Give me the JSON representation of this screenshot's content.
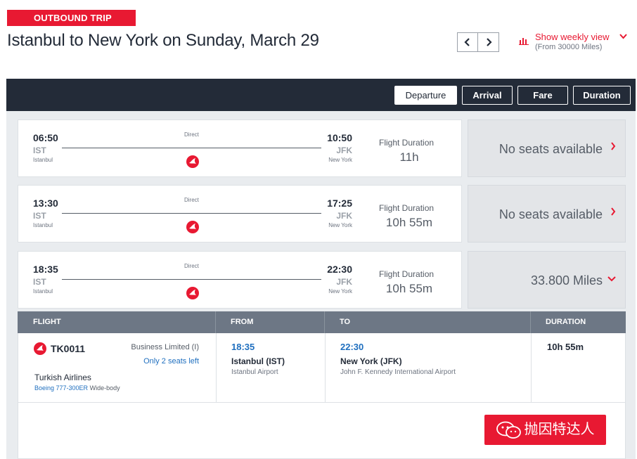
{
  "header": {
    "badge": "OUTBOUND TRIP",
    "title": "Istanbul to New York on Sunday, March 29",
    "weekly_label": "Show weekly view",
    "weekly_sub": "(From 30000 Miles)",
    "prev_icon": "chevron-left-icon",
    "next_icon": "chevron-right-icon"
  },
  "sort": {
    "departure": "Departure",
    "arrival": "Arrival",
    "fare": "Fare",
    "duration": "Duration",
    "active": "Departure"
  },
  "flights": [
    {
      "dep_time": "06:50",
      "dep_code": "IST",
      "dep_name": "Istanbul",
      "stops": "Direct",
      "arr_time": "10:50",
      "arr_code": "JFK",
      "arr_name": "New York",
      "duration_label": "Flight Duration",
      "duration": "11h",
      "fare": "No seats available"
    },
    {
      "dep_time": "13:30",
      "dep_code": "IST",
      "dep_name": "Istanbul",
      "stops": "Direct",
      "arr_time": "17:25",
      "arr_code": "JFK",
      "arr_name": "New York",
      "duration_label": "Flight Duration",
      "duration": "10h 55m",
      "fare": "No seats available"
    },
    {
      "dep_time": "18:35",
      "dep_code": "IST",
      "dep_name": "Istanbul",
      "stops": "Direct",
      "arr_time": "22:30",
      "arr_code": "JFK",
      "arr_name": "New York",
      "duration_label": "Flight Duration",
      "duration": "10h 55m",
      "fare": "33.800 Miles"
    }
  ],
  "detail": {
    "headers": {
      "flight": "FLIGHT",
      "from": "FROM",
      "to": "TO",
      "duration": "DURATION"
    },
    "flight_no": "TK0011",
    "cabin": "Business Limited (I)",
    "seats": "Only 2 seats left",
    "airline": "Turkish Airlines",
    "aircraft": "Boeing 777-300ER",
    "aircraft_type": "Wide-body",
    "from_time": "18:35",
    "from_city": "Istanbul (IST)",
    "from_airport": "Istanbul Airport",
    "to_time": "22:30",
    "to_city": "New York (JFK)",
    "to_airport": "John F. Kennedy International Airport",
    "duration": "10h 55m"
  },
  "watermark": "抛因特达人",
  "colors": {
    "brand_red": "#e81932",
    "dark_navy": "#232b38",
    "link_blue": "#1f6fbf",
    "header_gray": "#6d7785",
    "fare_bg": "#e3e5e8"
  }
}
